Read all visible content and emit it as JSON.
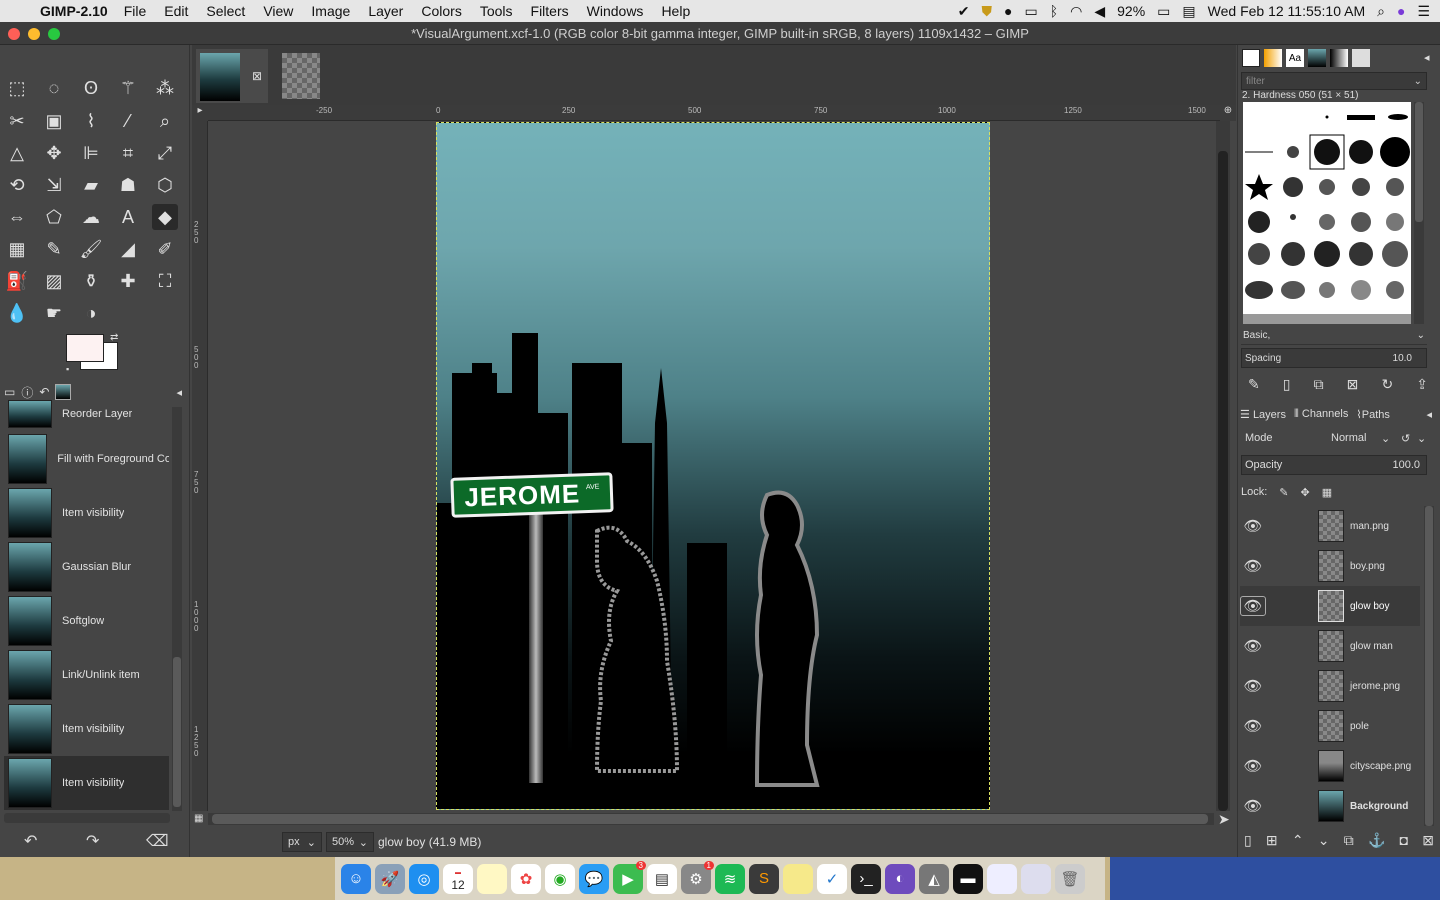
{
  "menubar": {
    "app": "GIMP-2.10",
    "items": [
      "File",
      "Edit",
      "Select",
      "View",
      "Image",
      "Layer",
      "Colors",
      "Tools",
      "Filters",
      "Windows",
      "Help"
    ],
    "battery": "92%",
    "datetime": "Wed Feb 12  11:55:10 AM"
  },
  "window": {
    "title": "*VisualArgument.xcf-1.0 (RGB color 8-bit gamma integer, GIMP built-in sRGB, 8 layers) 1109x1432 – GIMP"
  },
  "history": {
    "items": [
      {
        "label": "Reorder Layer"
      },
      {
        "label": "Fill with Foreground Color"
      },
      {
        "label": "Item visibility"
      },
      {
        "label": "Gaussian Blur"
      },
      {
        "label": "Softglow"
      },
      {
        "label": "Link/Unlink item"
      },
      {
        "label": "Item visibility"
      },
      {
        "label": "Item visibility"
      }
    ]
  },
  "canvas": {
    "ruler_ticks": [
      "-250",
      "0",
      "250",
      "500",
      "750",
      "1000",
      "1250",
      "1500"
    ],
    "vruler_ticks": [
      "250",
      "500",
      "750",
      "1000",
      "1250"
    ],
    "sign_text": "JEROME",
    "sign_suffix": "AVE"
  },
  "status": {
    "unit": "px",
    "zoom": "50%",
    "message": "glow boy (41.9 MB)"
  },
  "brushes": {
    "filter_placeholder": "filter",
    "current": "2. Hardness 050 (51 × 51)",
    "tag": "Basic,",
    "spacing_label": "Spacing",
    "spacing_value": "10.0"
  },
  "layers_panel": {
    "tabs": [
      "Layers",
      "Channels",
      "Paths"
    ],
    "mode_label": "Mode",
    "mode_value": "Normal",
    "opacity_label": "Opacity",
    "opacity_value": "100.0",
    "lock_label": "Lock:",
    "layers": [
      {
        "name": "man.png"
      },
      {
        "name": "boy.png"
      },
      {
        "name": "glow boy"
      },
      {
        "name": "glow man"
      },
      {
        "name": "jerome.png"
      },
      {
        "name": "pole"
      },
      {
        "name": "cityscape.png"
      },
      {
        "name": "Background"
      }
    ]
  },
  "dock": {
    "calendar_day": "12",
    "facetime_badge": "3",
    "prefs_badge": "1"
  }
}
